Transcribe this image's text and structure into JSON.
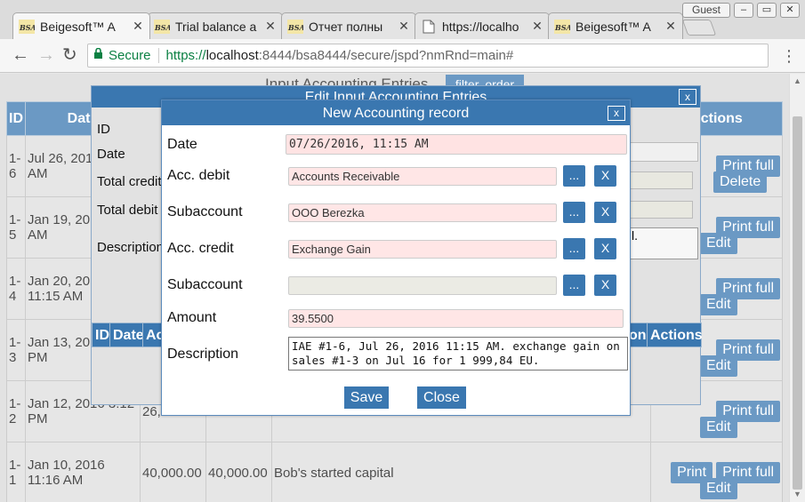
{
  "browser": {
    "tabs": [
      {
        "title": "Beigesoft™ A",
        "active": true
      },
      {
        "title": "Trial balance a",
        "active": false
      },
      {
        "title": "Отчет полны",
        "active": false
      },
      {
        "title": "https://localho",
        "active": false
      },
      {
        "title": "Beigesoft™ A",
        "active": false
      }
    ],
    "favicon_text": "BSA",
    "guest_label": "Guest",
    "secure_label": "Secure",
    "url_scheme": "https://",
    "url_host": "localhost",
    "url_rest": ":8444/bsa8444/secure/jspd?nmRnd=main#"
  },
  "page": {
    "title": "Input Accounting Entries",
    "filter_label": "filter, order",
    "table": {
      "headers": {
        "id": "ID",
        "date": "Date",
        "actions": "Actions"
      },
      "rows": [
        {
          "id": "1-6",
          "date": "Jul 26, 2016 11:15 AM",
          "debit": "",
          "credit": "",
          "description": "",
          "buttons": [
            "Print full",
            "Delete"
          ]
        },
        {
          "id": "1-5",
          "date": "Jan 19, 2016 9:46 AM",
          "debit": "",
          "credit": "",
          "description": "",
          "buttons": [
            "Print full",
            "Edit"
          ]
        },
        {
          "id": "1-4",
          "date": "Jan 20, 2016 11:15 AM",
          "debit": "",
          "credit": "",
          "description": "",
          "buttons": [
            "Print full",
            "Edit"
          ]
        },
        {
          "id": "1-3",
          "date": "Jan 13, 2016 3:27 PM",
          "debit": "",
          "credit": "",
          "description": "",
          "buttons": [
            "Print full",
            "Edit"
          ]
        },
        {
          "id": "1-2",
          "date": "Jan 12, 2016 3:12 PM",
          "debit": "26,",
          "credit": "",
          "description": "",
          "buttons": [
            "Print full",
            "Edit"
          ]
        },
        {
          "id": "1-1",
          "date": "Jan 10, 2016 11:16 AM",
          "debit": "40,000.00",
          "credit": "40,000.00",
          "description": "Bob's started capital",
          "buttons": [
            "Print",
            "Print full",
            "Edit"
          ]
        }
      ]
    }
  },
  "edit_dialog": {
    "title": "Edit Input Accounting Entries",
    "close": "x",
    "labels": [
      "ID",
      "Date",
      "Total credit",
      "Total debit",
      "Description"
    ],
    "ta_fragment": "l.",
    "inner_headers": {
      "id": "ID",
      "date": "Date",
      "ac": "Ac",
      "on": "on",
      "actions": "Actions"
    }
  },
  "new_dialog": {
    "title": "New Accounting record",
    "close": "x",
    "labels": {
      "date": "Date",
      "acc_debit": "Acc. debit",
      "sub_debit": "Subaccount",
      "acc_credit": "Acc. credit",
      "sub_credit": "Subaccount",
      "amount": "Amount",
      "description": "Description"
    },
    "values": {
      "date": "07/26/2016, 11:15 AM",
      "acc_debit": "Accounts Receivable",
      "sub_debit": "OOO Berezka",
      "acc_credit": "Exchange Gain",
      "sub_credit": "",
      "amount": "39.5500",
      "description": "IAE #1-6, Jul 26, 2016 11:15 AM. exchange gain on sales #1-3 on Jul 16 for 1 999,84 EU."
    },
    "select_btn": "...",
    "clear_btn": "X",
    "save_label": "Save",
    "close_label": "Close"
  }
}
